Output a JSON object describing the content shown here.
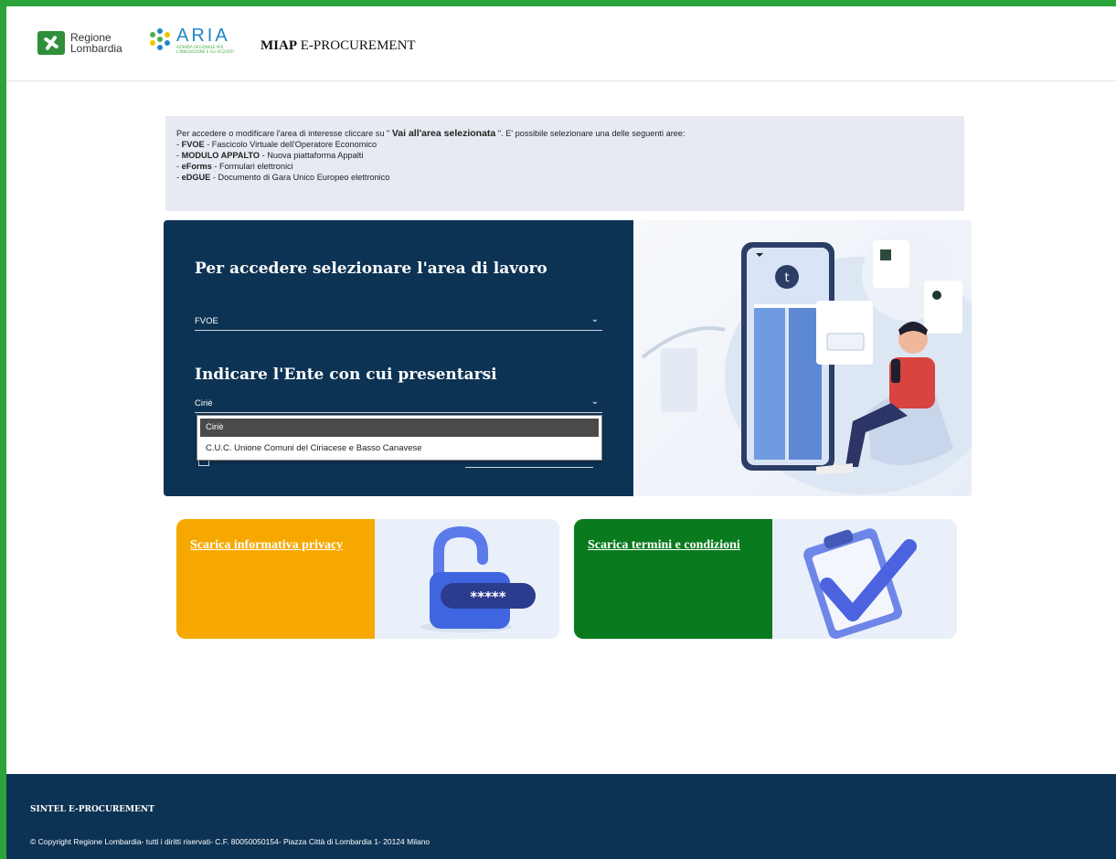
{
  "header": {
    "rl_logo_line1": "Regione",
    "rl_logo_line2": "Lombardia",
    "aria_logo_text": "ARIA",
    "aria_logo_sub": "AZIENDA REGIONALE PER L'INNOVAZIONE E GLI ACQUISTI",
    "app_title_bold": "MIAP",
    "app_title_rest": " E-PROCUREMENT"
  },
  "info": {
    "intro_pre": "Per accedere o modificare l'area di interesse cliccare su \" ",
    "intro_action": "Vai all'area selezionata",
    "intro_post": " \". E' possibile selezionare una delle seguenti aree:",
    "areas": [
      {
        "key": "FVOE",
        "desc": " - Fascicolo Virtuale dell'Operatore Economico"
      },
      {
        "key": "MODULO APPALTO",
        "desc": " - Nuova piattaforma Appalti"
      },
      {
        "key": "eForms",
        "desc": " - Formulari elettronici"
      },
      {
        "key": "eDGUE",
        "desc": " - Documento di Gara Unico Europeo elettronico"
      }
    ]
  },
  "panel": {
    "area_heading": "Per accedere selezionare l'area di lavoro",
    "area_value": "FVOE",
    "ente_heading": "Indicare l'Ente con cui presentarsi",
    "ente_value": "Ciriè",
    "ente_options": [
      "Ciriè",
      "C.U.C. Unione Comuni del Ciriacese e Basso Canavese"
    ]
  },
  "cards": {
    "privacy_link": "Scarica informativa privacy",
    "privacy_color": "#f6a800",
    "terms_link": "Scarica termini e condizioni",
    "terms_color": "#0a7a1e"
  },
  "footer": {
    "title": "SINTEL E-PROCUREMENT",
    "copyright": "© Copyright Regione Lombardia- tutti i diritti riservati- C.F. 80050050154- Piazza Città di Lombardia 1- 20124 Milano"
  },
  "icons": {
    "chevron": "⌄",
    "privacy_image": "padlock-password-illustration",
    "terms_image": "clipboard-checkmark-illustration",
    "hero_image": "person-with-phone-illustration"
  }
}
